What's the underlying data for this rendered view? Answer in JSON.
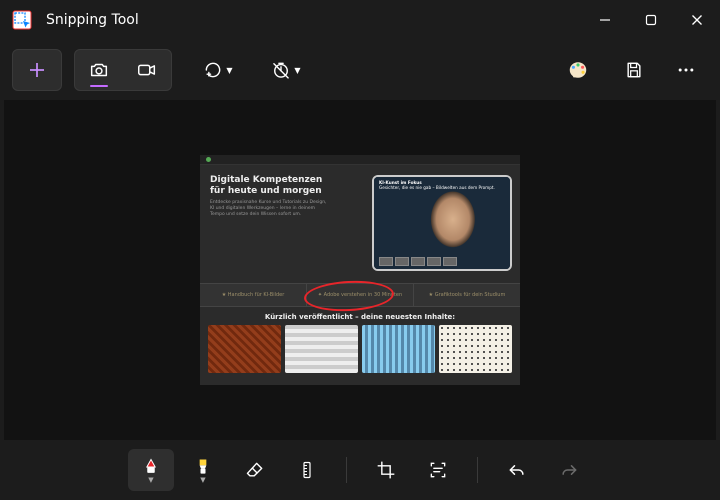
{
  "app": {
    "title": "Snipping Tool"
  },
  "screenshot": {
    "hero_title_1": "Digitale Kompetenzen",
    "hero_title_2": "für heute und morgen",
    "hero_body": "Entdecke praxisnahe Kurse und Tutorials zu Design, KI und digitalen Werkzeugen – lerne in deinem Tempo und setze dein Wissen sofort um.",
    "tablet_line1": "KI-Kunst im Fokus",
    "tablet_line2": "Gesichter, die es nie gab – Bildwelten aus dem Prompt.",
    "ribbon_1": "★ Handbuch für KI-Bilder",
    "ribbon_2": "✦ Adobe verstehen in 30 Minuten",
    "ribbon_3": "★ Grafiktools für dein Studium",
    "recent_label": "Kürzlich veröffentlicht – deine neuesten Inhalte:"
  },
  "colors": {
    "accent": "#c46bff",
    "annotation_red": "#e8252a",
    "highlighter_yellow": "#ffd43b"
  }
}
